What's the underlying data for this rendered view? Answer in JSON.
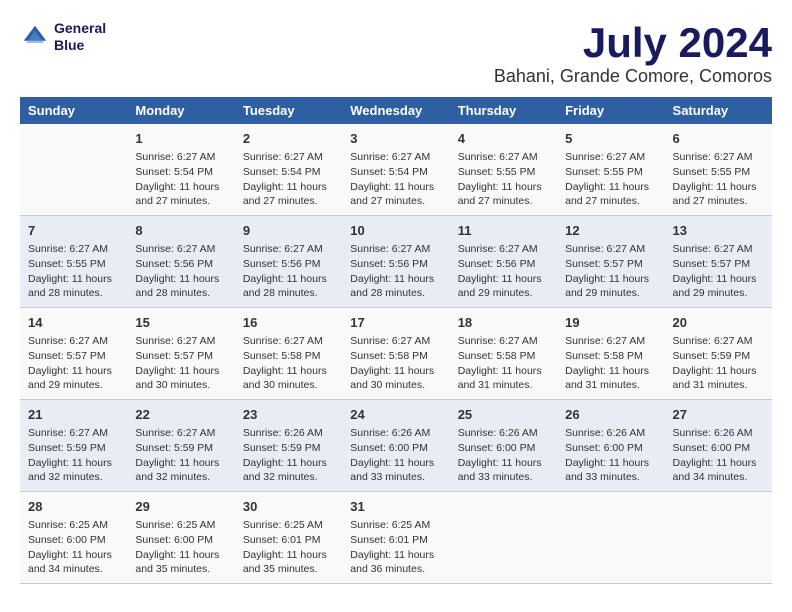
{
  "header": {
    "logo_line1": "General",
    "logo_line2": "Blue",
    "title": "July 2024",
    "subtitle": "Bahani, Grande Comore, Comoros"
  },
  "days_of_week": [
    "Sunday",
    "Monday",
    "Tuesday",
    "Wednesday",
    "Thursday",
    "Friday",
    "Saturday"
  ],
  "weeks": [
    [
      {
        "day": "",
        "content": ""
      },
      {
        "day": "1",
        "content": "Sunrise: 6:27 AM\nSunset: 5:54 PM\nDaylight: 11 hours\nand 27 minutes."
      },
      {
        "day": "2",
        "content": "Sunrise: 6:27 AM\nSunset: 5:54 PM\nDaylight: 11 hours\nand 27 minutes."
      },
      {
        "day": "3",
        "content": "Sunrise: 6:27 AM\nSunset: 5:54 PM\nDaylight: 11 hours\nand 27 minutes."
      },
      {
        "day": "4",
        "content": "Sunrise: 6:27 AM\nSunset: 5:55 PM\nDaylight: 11 hours\nand 27 minutes."
      },
      {
        "day": "5",
        "content": "Sunrise: 6:27 AM\nSunset: 5:55 PM\nDaylight: 11 hours\nand 27 minutes."
      },
      {
        "day": "6",
        "content": "Sunrise: 6:27 AM\nSunset: 5:55 PM\nDaylight: 11 hours\nand 27 minutes."
      }
    ],
    [
      {
        "day": "7",
        "content": "Sunrise: 6:27 AM\nSunset: 5:55 PM\nDaylight: 11 hours\nand 28 minutes."
      },
      {
        "day": "8",
        "content": "Sunrise: 6:27 AM\nSunset: 5:56 PM\nDaylight: 11 hours\nand 28 minutes."
      },
      {
        "day": "9",
        "content": "Sunrise: 6:27 AM\nSunset: 5:56 PM\nDaylight: 11 hours\nand 28 minutes."
      },
      {
        "day": "10",
        "content": "Sunrise: 6:27 AM\nSunset: 5:56 PM\nDaylight: 11 hours\nand 28 minutes."
      },
      {
        "day": "11",
        "content": "Sunrise: 6:27 AM\nSunset: 5:56 PM\nDaylight: 11 hours\nand 29 minutes."
      },
      {
        "day": "12",
        "content": "Sunrise: 6:27 AM\nSunset: 5:57 PM\nDaylight: 11 hours\nand 29 minutes."
      },
      {
        "day": "13",
        "content": "Sunrise: 6:27 AM\nSunset: 5:57 PM\nDaylight: 11 hours\nand 29 minutes."
      }
    ],
    [
      {
        "day": "14",
        "content": "Sunrise: 6:27 AM\nSunset: 5:57 PM\nDaylight: 11 hours\nand 29 minutes."
      },
      {
        "day": "15",
        "content": "Sunrise: 6:27 AM\nSunset: 5:57 PM\nDaylight: 11 hours\nand 30 minutes."
      },
      {
        "day": "16",
        "content": "Sunrise: 6:27 AM\nSunset: 5:58 PM\nDaylight: 11 hours\nand 30 minutes."
      },
      {
        "day": "17",
        "content": "Sunrise: 6:27 AM\nSunset: 5:58 PM\nDaylight: 11 hours\nand 30 minutes."
      },
      {
        "day": "18",
        "content": "Sunrise: 6:27 AM\nSunset: 5:58 PM\nDaylight: 11 hours\nand 31 minutes."
      },
      {
        "day": "19",
        "content": "Sunrise: 6:27 AM\nSunset: 5:58 PM\nDaylight: 11 hours\nand 31 minutes."
      },
      {
        "day": "20",
        "content": "Sunrise: 6:27 AM\nSunset: 5:59 PM\nDaylight: 11 hours\nand 31 minutes."
      }
    ],
    [
      {
        "day": "21",
        "content": "Sunrise: 6:27 AM\nSunset: 5:59 PM\nDaylight: 11 hours\nand 32 minutes."
      },
      {
        "day": "22",
        "content": "Sunrise: 6:27 AM\nSunset: 5:59 PM\nDaylight: 11 hours\nand 32 minutes."
      },
      {
        "day": "23",
        "content": "Sunrise: 6:26 AM\nSunset: 5:59 PM\nDaylight: 11 hours\nand 32 minutes."
      },
      {
        "day": "24",
        "content": "Sunrise: 6:26 AM\nSunset: 6:00 PM\nDaylight: 11 hours\nand 33 minutes."
      },
      {
        "day": "25",
        "content": "Sunrise: 6:26 AM\nSunset: 6:00 PM\nDaylight: 11 hours\nand 33 minutes."
      },
      {
        "day": "26",
        "content": "Sunrise: 6:26 AM\nSunset: 6:00 PM\nDaylight: 11 hours\nand 33 minutes."
      },
      {
        "day": "27",
        "content": "Sunrise: 6:26 AM\nSunset: 6:00 PM\nDaylight: 11 hours\nand 34 minutes."
      }
    ],
    [
      {
        "day": "28",
        "content": "Sunrise: 6:25 AM\nSunset: 6:00 PM\nDaylight: 11 hours\nand 34 minutes."
      },
      {
        "day": "29",
        "content": "Sunrise: 6:25 AM\nSunset: 6:00 PM\nDaylight: 11 hours\nand 35 minutes."
      },
      {
        "day": "30",
        "content": "Sunrise: 6:25 AM\nSunset: 6:01 PM\nDaylight: 11 hours\nand 35 minutes."
      },
      {
        "day": "31",
        "content": "Sunrise: 6:25 AM\nSunset: 6:01 PM\nDaylight: 11 hours\nand 36 minutes."
      },
      {
        "day": "",
        "content": ""
      },
      {
        "day": "",
        "content": ""
      },
      {
        "day": "",
        "content": ""
      }
    ]
  ]
}
